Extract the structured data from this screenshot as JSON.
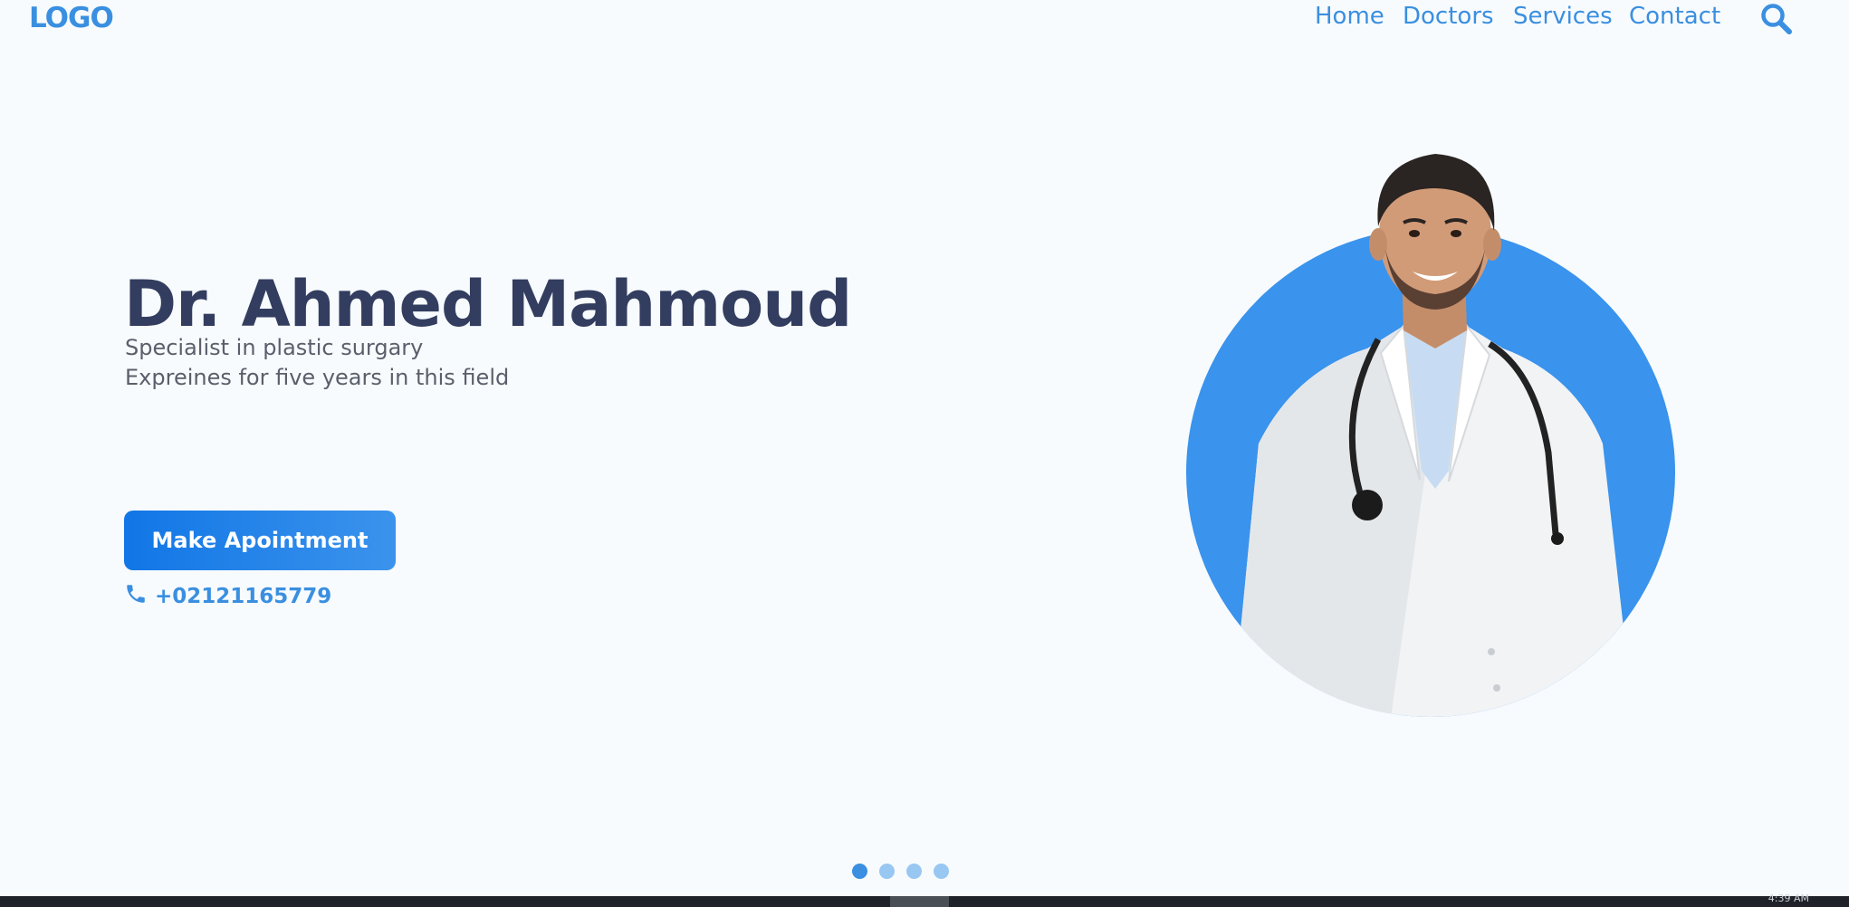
{
  "header": {
    "logo": "LOGO",
    "nav": [
      {
        "label": "Home"
      },
      {
        "label": "Doctors"
      },
      {
        "label": "Services"
      },
      {
        "label": "Contact"
      }
    ],
    "search_icon": "search-icon"
  },
  "hero": {
    "name": "Dr. Ahmed Mahmoud",
    "specialty": "Specialist in plastic surgary",
    "experience": "Expreines for five years in this field",
    "cta_label": "Make Apointment",
    "phone": "+02121165779",
    "phone_icon": "phone-icon"
  },
  "carousel": {
    "slide_count": 4,
    "active_slide": 1
  },
  "taskbar": {
    "clock": "4:39 AM"
  },
  "colors": {
    "accent": "#3a8fe0",
    "heading": "#333d5f",
    "background": "#f7fbfe",
    "circle": "#3a93ec"
  }
}
